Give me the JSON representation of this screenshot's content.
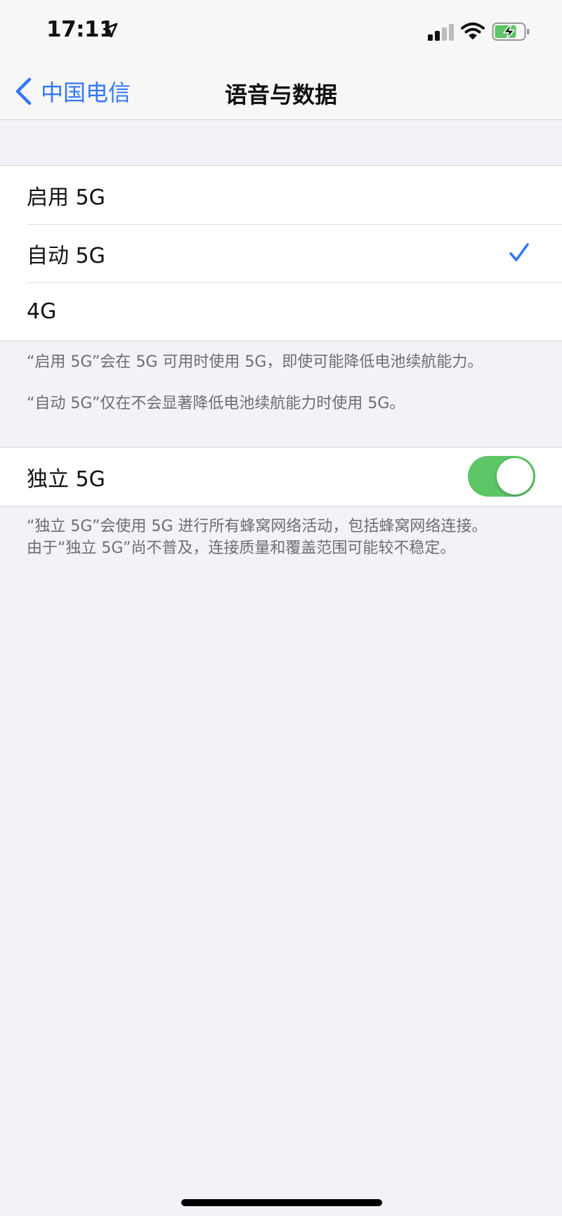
{
  "status_bar": {
    "time": "17:11",
    "icons": [
      "location-arrow-icon",
      "cellular-signal-icon",
      "wifi-icon",
      "battery-charging-icon"
    ]
  },
  "nav": {
    "back_label": "中国电信",
    "title": "语音与数据"
  },
  "network_options": [
    {
      "label": "启用 5G",
      "selected": false
    },
    {
      "label": "自动 5G",
      "selected": true
    },
    {
      "label": "4G",
      "selected": false
    }
  ],
  "network_footer": {
    "line1": "“启用 5G”会在 5G 可用时使用 5G，即使可能降低电池续航能力。",
    "line2": "“自动 5G”仅在不会显著降低电池续航能力时使用 5G。"
  },
  "standalone": {
    "label": "独立 5G",
    "enabled": true,
    "footer_line1": "“独立 5G”会使用 5G 进行所有蜂窝网络活动，包括蜂窝网络连接。",
    "footer_line2": "由于“独立 5G”尚不普及，连接质量和覆盖范围可能较不稳定。"
  },
  "colors": {
    "accent": "#3478f6",
    "toggle_on": "#5cc565",
    "background": "#f2f2f7",
    "footer_text": "#6d6d72"
  }
}
